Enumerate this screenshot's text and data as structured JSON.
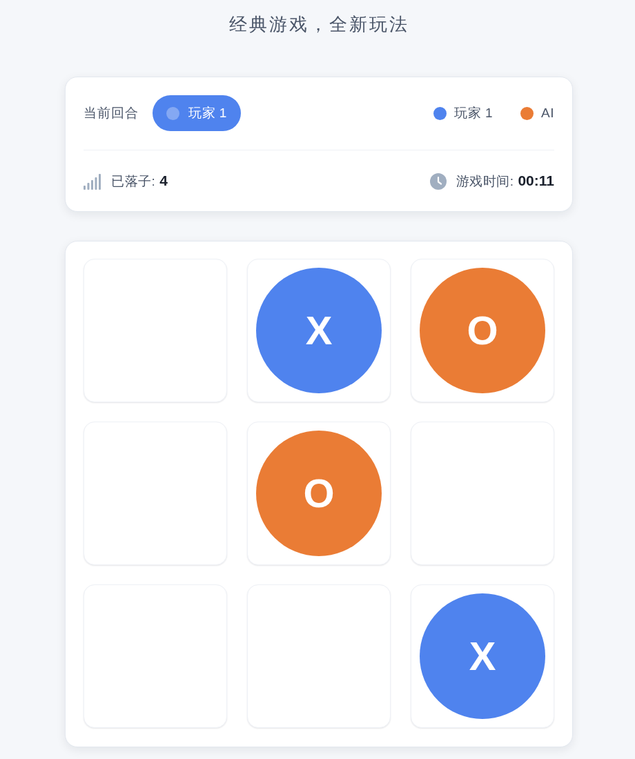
{
  "subtitle": "经典游戏，全新玩法",
  "status": {
    "turn_label": "当前回合",
    "current_player": {
      "label": "玩家 1",
      "color": "#4f83ee"
    },
    "legend": [
      {
        "label": "玩家 1",
        "color": "#4f83ee"
      },
      {
        "label": "AI",
        "color": "#ea7c35"
      }
    ],
    "moves_label": "已落子:",
    "moves": "4",
    "time_label": "游戏时间:",
    "time": "00:11"
  },
  "board": {
    "cells": [
      {
        "kind": "empty"
      },
      {
        "kind": "piece",
        "label": "X",
        "color": "#4f83ee"
      },
      {
        "kind": "piece",
        "label": "O",
        "color": "#ea7c35"
      },
      {
        "kind": "empty"
      },
      {
        "kind": "piece",
        "label": "O",
        "color": "#ea7c35"
      },
      {
        "kind": "empty"
      },
      {
        "kind": "empty"
      },
      {
        "kind": "empty"
      },
      {
        "kind": "piece",
        "label": "X",
        "color": "#4f83ee"
      }
    ]
  }
}
